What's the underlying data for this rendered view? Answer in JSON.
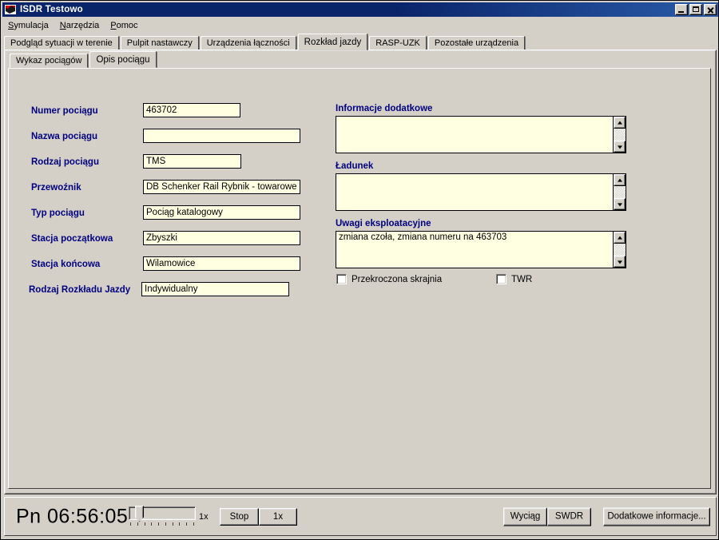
{
  "window": {
    "title": "ISDR Testowo",
    "icon": "app-flag-icon",
    "controls": {
      "minimize": "_",
      "maximize": "□",
      "close": "✕"
    }
  },
  "menu": {
    "items": [
      {
        "label": "Symulacja",
        "mnemonic": "S"
      },
      {
        "label": "Narzędzia",
        "mnemonic": "N"
      },
      {
        "label": "Pomoc",
        "mnemonic": "P"
      }
    ]
  },
  "outer_tabs": {
    "active": "Rozkład jazdy",
    "items": [
      {
        "label": "Podgląd sytuacji w terenie",
        "active": false
      },
      {
        "label": "Pulpit nastawczy",
        "active": false
      },
      {
        "label": "Urządzenia łączności",
        "active": false
      },
      {
        "label": "Rozkład jazdy",
        "active": true
      },
      {
        "label": "RASP-UZK",
        "active": false
      },
      {
        "label": "Pozostałe urządzenia",
        "active": false
      }
    ]
  },
  "inner_tabs": {
    "active": "Opis pociągu",
    "items": [
      {
        "label": "Wykaz pociągów",
        "active": false
      },
      {
        "label": "Opis pociągu",
        "active": true
      }
    ]
  },
  "form": {
    "fields": [
      {
        "label": "Numer pociągu",
        "value": "463702"
      },
      {
        "label": "Nazwa pociągu",
        "value": ""
      },
      {
        "label": "Rodzaj pociągu",
        "value": "TMS"
      },
      {
        "label": "Przewoźnik",
        "value": "DB Schenker Rail Rybnik - towarowe"
      },
      {
        "label": "Typ pociągu",
        "value": "Pociąg katalogowy"
      },
      {
        "label": "Stacja początkowa",
        "value": "Zbyszki"
      },
      {
        "label": "Stacja końcowa",
        "value": "Wilamowice"
      },
      {
        "label": "Rodzaj Rozkładu Jazdy",
        "value": "Indywidualny"
      }
    ]
  },
  "memos": [
    {
      "heading": "Informacje dodatkowe",
      "value": ""
    },
    {
      "heading": "Ładunek",
      "value": ""
    },
    {
      "heading": "Uwagi eksploatacyjne",
      "value": "zmiana czoła, zmiana numeru na 463703"
    }
  ],
  "checkboxes": [
    {
      "label": "Przekroczona skrajnia",
      "checked": false
    },
    {
      "label": "TWR",
      "checked": false
    }
  ],
  "statusbar": {
    "day": "Pn",
    "time": "06:56:05",
    "clock": "Pn  06:56:05",
    "speed_label": "1x",
    "stop_label": "Stop",
    "speed_button_label": "1x",
    "wyciag_label": "Wyciąg",
    "swdr_label": "SWDR",
    "dodatkowe_label": "Dodatkowe informacje..."
  },
  "colors": {
    "title_bar": "#0a246a",
    "face": "#d4d0c8",
    "field_bg": "#ffffe1",
    "label_text": "#000080"
  }
}
